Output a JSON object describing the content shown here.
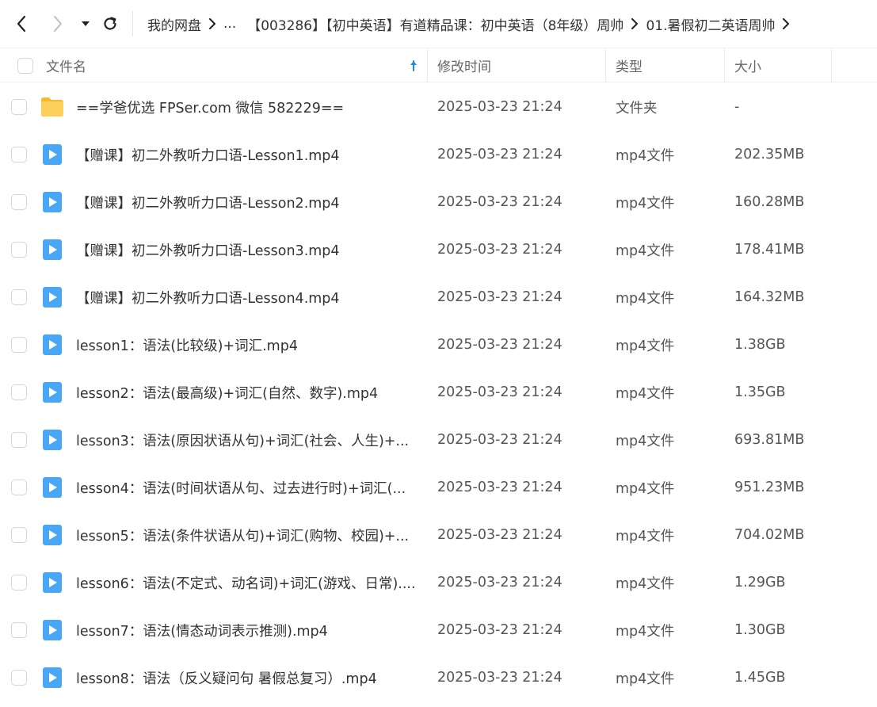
{
  "nav": {
    "back_icon": "chevron-left-icon",
    "forward_icon": "chevron-right-icon",
    "history_icon": "caret-down-icon",
    "refresh_icon": "refresh-icon"
  },
  "breadcrumb": {
    "items": [
      "我的网盘",
      "...",
      "【003286】【初中英语】有道精品课：初中英语（8年级）周帅",
      "01.暑假初二英语周帅"
    ]
  },
  "table": {
    "headers": {
      "name": "文件名",
      "time": "修改时间",
      "type": "类型",
      "size": "大小"
    },
    "sort_icon": "sort-arrow-up-icon",
    "sort_color": "#1e88e5",
    "rows": [
      {
        "name": "==学爸优选 FPSer.com 微信 582229==",
        "time": "2025-03-23 21:24",
        "type": "文件夹",
        "size": "-",
        "icon": "folder-icon"
      },
      {
        "name": "【赠课】初二外教听力口语-Lesson1.mp4",
        "time": "2025-03-23 21:24",
        "type": "mp4文件",
        "size": "202.35MB",
        "icon": "video-file-icon"
      },
      {
        "name": "【赠课】初二外教听力口语-Lesson2.mp4",
        "time": "2025-03-23 21:24",
        "type": "mp4文件",
        "size": "160.28MB",
        "icon": "video-file-icon"
      },
      {
        "name": "【赠课】初二外教听力口语-Lesson3.mp4",
        "time": "2025-03-23 21:24",
        "type": "mp4文件",
        "size": "178.41MB",
        "icon": "video-file-icon"
      },
      {
        "name": "【赠课】初二外教听力口语-Lesson4.mp4",
        "time": "2025-03-23 21:24",
        "type": "mp4文件",
        "size": "164.32MB",
        "icon": "video-file-icon"
      },
      {
        "name": "lesson1：语法(比较级)+词汇.mp4",
        "time": "2025-03-23 21:24",
        "type": "mp4文件",
        "size": "1.38GB",
        "icon": "video-file-icon"
      },
      {
        "name": "lesson2：语法(最高级)+词汇(自然、数字).mp4",
        "time": "2025-03-23 21:24",
        "type": "mp4文件",
        "size": "1.35GB",
        "icon": "video-file-icon"
      },
      {
        "name": "lesson3：语法(原因状语从句)+词汇(社会、人生)+...",
        "time": "2025-03-23 21:24",
        "type": "mp4文件",
        "size": "693.81MB",
        "icon": "video-file-icon"
      },
      {
        "name": "lesson4：语法(时间状语从句、过去进行时)+词汇(...",
        "time": "2025-03-23 21:24",
        "type": "mp4文件",
        "size": "951.23MB",
        "icon": "video-file-icon"
      },
      {
        "name": "lesson5：语法(条件状语从句)+词汇(购物、校园)+...",
        "time": "2025-03-23 21:24",
        "type": "mp4文件",
        "size": "704.02MB",
        "icon": "video-file-icon"
      },
      {
        "name": "lesson6：语法(不定式、动名词)+词汇(游戏、日常)....",
        "time": "2025-03-23 21:24",
        "type": "mp4文件",
        "size": "1.29GB",
        "icon": "video-file-icon"
      },
      {
        "name": "lesson7：语法(情态动词表示推测).mp4",
        "time": "2025-03-23 21:24",
        "type": "mp4文件",
        "size": "1.30GB",
        "icon": "video-file-icon"
      },
      {
        "name": "lesson8：语法（反义疑问句 暑假总复习）.mp4",
        "time": "2025-03-23 21:24",
        "type": "mp4文件",
        "size": "1.45GB",
        "icon": "video-file-icon"
      }
    ]
  },
  "colors": {
    "folder": "#f7c243",
    "video": "#4aa7f5",
    "text": "#333333",
    "muted": "#555555"
  }
}
